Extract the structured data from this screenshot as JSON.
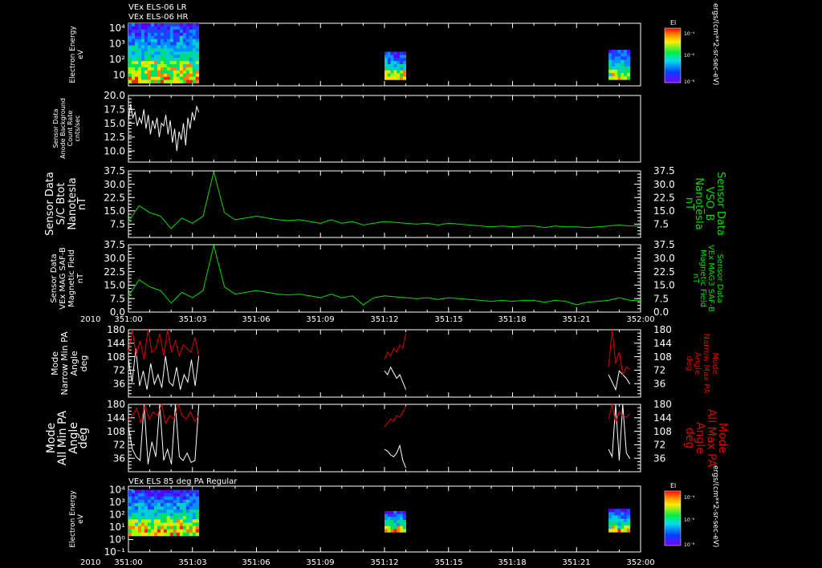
{
  "colors": {
    "background": "#000000",
    "white": "#ffffff",
    "green": "#00dd00",
    "red": "#dd0000"
  },
  "header": {
    "line1": "VEx ELS-06 LR",
    "line2": "VEx ELS-06 HR"
  },
  "time_axis": {
    "year": "2010",
    "ticks": [
      "351:00",
      "351:03",
      "351:06",
      "351:09",
      "351:12",
      "351:15",
      "351:18",
      "351:21",
      "352:00"
    ]
  },
  "chart_data": [
    {
      "type": "heatmap",
      "title": "VEx ELS-06 LR / VEx ELS-06 HR",
      "ylabel": [
        "Electron Energy",
        "eV"
      ],
      "yscale": "log",
      "yticks": [
        "10",
        "10²",
        "10³",
        "10⁴"
      ],
      "colorbar": {
        "label": "El",
        "units": "ergs/(cm**2-sr-sec-eV)",
        "ticks": [
          "10⁻⁴",
          "10⁻⁶",
          "10⁻⁸"
        ]
      },
      "data_blocks": [
        {
          "t_start": "351:00",
          "t_end": "351:03.3",
          "e_min": 3,
          "e_max": 20000
        },
        {
          "t_start": "351:12",
          "t_end": "351:13",
          "e_min": 5,
          "e_max": 300
        },
        {
          "t_start": "351:22.5",
          "t_end": "351:23.5",
          "e_min": 5,
          "e_max": 400
        }
      ]
    },
    {
      "type": "line",
      "ylabel": [
        "Sensor Data",
        "Anode Background",
        "Count Rate",
        "cnts/sec"
      ],
      "ylim": [
        8,
        20
      ],
      "yticks": [
        "10.0",
        "12.5",
        "15.0",
        "17.5",
        "20.0"
      ],
      "series": [
        {
          "color": "white",
          "t_start": 0,
          "t_end": 3.3,
          "values": [
            15.5,
            18.5,
            16,
            17,
            14.5,
            16,
            15,
            17.5,
            14,
            16.5,
            13,
            15.5,
            14,
            16,
            12.5,
            15,
            14.5,
            16.5,
            13,
            15.5,
            11.5,
            14,
            10,
            13.5,
            12,
            15,
            11,
            16,
            14,
            17,
            15.5,
            18,
            17
          ]
        }
      ]
    },
    {
      "type": "line",
      "ylabel": [
        "Sensor Data",
        "S/C Btot",
        "Nanotesla",
        "nT"
      ],
      "ylabel_right": [
        "Sensor Data",
        "VSO_B",
        "Nanotesla",
        "nT"
      ],
      "ylim": [
        0,
        37.5
      ],
      "yticks": [
        "7.5",
        "15.0",
        "22.5",
        "30.0",
        "37.5"
      ],
      "series": [
        {
          "color": "green",
          "t_start": 0,
          "t_end": 24,
          "values": [
            9,
            18,
            14,
            12,
            5,
            11,
            8,
            12,
            37,
            14,
            10,
            11,
            12,
            11,
            10,
            9.5,
            10,
            9,
            8,
            10,
            8,
            9,
            7,
            8,
            9,
            8.5,
            8,
            7.5,
            8,
            7,
            8,
            7.5,
            7,
            6.5,
            6,
            6.5,
            6,
            6.5,
            6.5,
            5.5,
            6.5,
            6,
            6,
            5.5,
            6,
            6.5,
            7,
            6.5,
            6.5
          ]
        }
      ]
    },
    {
      "type": "line",
      "ylabel": [
        "Sensor Data",
        "VEx MAG SAF-B",
        "Magnetic Field",
        "nT"
      ],
      "ylabel_right": [
        "Sensor Data",
        "VEx MAG3 SAF-B",
        "Magnetic Field",
        "nT"
      ],
      "ylim": [
        0,
        37.5
      ],
      "yticks": [
        "0.0",
        "7.5",
        "15.0",
        "22.5",
        "30.0",
        "37.5"
      ],
      "series": [
        {
          "color": "green",
          "t_start": 0,
          "t_end": 24,
          "values": [
            9,
            18,
            14,
            12,
            5,
            11,
            8,
            12,
            37,
            14,
            10,
            11,
            12,
            11,
            10,
            9.5,
            10,
            9,
            8,
            10,
            8,
            9,
            4,
            8,
            9,
            8.5,
            8,
            7.5,
            8,
            7,
            8,
            7.5,
            7,
            6.5,
            6,
            6.5,
            6,
            6.5,
            6.5,
            5.5,
            6.5,
            6,
            4,
            5.5,
            6,
            6.5,
            8,
            6.5,
            6.5
          ]
        }
      ]
    },
    {
      "type": "line",
      "ylabel": [
        "Mode",
        "Narrow Min PA",
        "Angle",
        "deg"
      ],
      "ylabel_right": [
        "Mode",
        "Narrow Max PA",
        "Angle",
        "deg"
      ],
      "ylim": [
        0,
        180
      ],
      "yticks": [
        "36",
        "72",
        "108",
        "144",
        "180"
      ],
      "series": [
        {
          "name": "Min PA",
          "color": "white",
          "segments": [
            {
              "t_start": 0,
              "t_end": 3.3,
              "values": [
                100,
                40,
                130,
                30,
                70,
                20,
                90,
                35,
                60,
                25,
                110,
                40,
                30,
                80,
                20,
                60,
                40,
                100,
                30,
                110
              ]
            },
            {
              "t_start": 12,
              "t_end": 13,
              "values": [
                70,
                60,
                80,
                65,
                50,
                60,
                40,
                20
              ]
            },
            {
              "t_start": 22.5,
              "t_end": 23.5,
              "values": [
                60,
                40,
                20,
                70,
                60,
                50,
                35
              ]
            }
          ]
        },
        {
          "name": "Max PA",
          "color": "red",
          "segments": [
            {
              "t_start": 0,
              "t_end": 3.3,
              "values": [
                120,
                180,
                110,
                150,
                100,
                180,
                120,
                130,
                170,
                110,
                180,
                120,
                150,
                110,
                140,
                130,
                120,
                160,
                110
              ]
            },
            {
              "t_start": 12,
              "t_end": 13,
              "values": [
                100,
                120,
                110,
                130,
                120,
                140,
                130,
                170
              ]
            },
            {
              "t_start": 22.5,
              "t_end": 23.5,
              "values": [
                80,
                180,
                90,
                120,
                60,
                80,
                75
              ]
            }
          ]
        }
      ]
    },
    {
      "type": "line",
      "ylabel": [
        "Mode",
        "All Min PA",
        "Angle",
        "deg"
      ],
      "ylabel_right": [
        "Mode",
        "All Max PA",
        "Angle",
        "deg"
      ],
      "ylim": [
        0,
        180
      ],
      "yticks": [
        "36",
        "72",
        "108",
        "144",
        "180"
      ],
      "series": [
        {
          "name": "Min PA",
          "color": "white",
          "segments": [
            {
              "t_start": 0,
              "t_end": 3.3,
              "values": [
                120,
                60,
                40,
                30,
                180,
                20,
                80,
                40,
                180,
                30,
                60,
                20,
                180,
                40,
                30,
                50,
                25,
                30,
                180
              ]
            },
            {
              "t_start": 12,
              "t_end": 13,
              "values": [
                60,
                55,
                45,
                40,
                50,
                70,
                30,
                10
              ]
            },
            {
              "t_start": 22.5,
              "t_end": 23.5,
              "values": [
                60,
                40,
                180,
                30,
                180,
                50,
                35
              ]
            }
          ]
        },
        {
          "name": "Max PA",
          "color": "red",
          "segments": [
            {
              "t_start": 0,
              "t_end": 3.3,
              "values": [
                140,
                150,
                170,
                130,
                180,
                140,
                160,
                150,
                180,
                130,
                150,
                140,
                180,
                150,
                140,
                160,
                135,
                150
              ]
            },
            {
              "t_start": 12,
              "t_end": 13,
              "values": [
                120,
                130,
                140,
                135,
                150,
                145,
                160,
                175
              ]
            },
            {
              "t_start": 22.5,
              "t_end": 23.5,
              "values": [
                140,
                180,
                130,
                160,
                150,
                145,
                155
              ]
            }
          ]
        }
      ]
    },
    {
      "type": "heatmap",
      "title": "VEx ELS 85 deg PA Regular",
      "ylabel": [
        "Electron Energy",
        "eV"
      ],
      "yscale": "log",
      "yticks": [
        "10⁻¹",
        "10⁰",
        "10¹",
        "10²",
        "10³",
        "10⁴"
      ],
      "colorbar": {
        "label": "El",
        "units": "ergs/(cm**2-sr-sec-eV)",
        "ticks": [
          "10⁻⁴",
          "10⁻⁶",
          "10⁻⁸"
        ]
      },
      "data_blocks": [
        {
          "t_start": "351:00",
          "t_end": "351:03.3",
          "e_min": 2,
          "e_max": 10000
        },
        {
          "t_start": "351:12",
          "t_end": "351:13",
          "e_min": 4,
          "e_max": 200
        },
        {
          "t_start": "351:22.5",
          "t_end": "351:23.5",
          "e_min": 4,
          "e_max": 300
        }
      ]
    }
  ]
}
